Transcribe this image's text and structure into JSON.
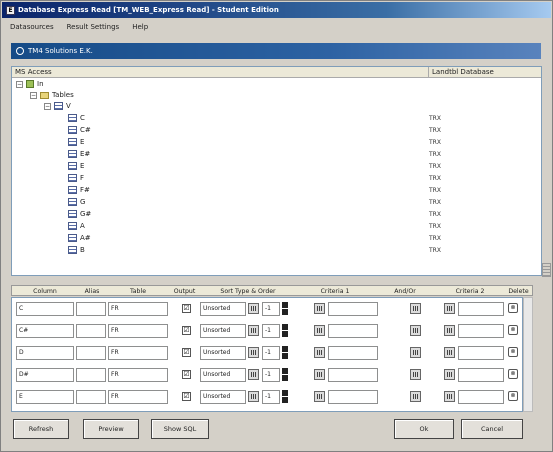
{
  "window": {
    "title": "Database Express Read [TM_WEB_Express Read] - Student Edition",
    "menu": [
      "Datasources",
      "Result Settings",
      "Help"
    ]
  },
  "panel": {
    "title": "TM4 Solutions E.K."
  },
  "tree": {
    "header_left": "MS Access",
    "header_right": "Landtbl Database",
    "root": "In",
    "tables_node": "Tables",
    "sub_node": "V",
    "items": [
      {
        "name": "C",
        "value": "TRX"
      },
      {
        "name": "C#",
        "value": "TRX"
      },
      {
        "name": "E",
        "value": "TRX"
      },
      {
        "name": "E#",
        "value": "TRX"
      },
      {
        "name": "E",
        "value": "TRX"
      },
      {
        "name": "F",
        "value": "TRX"
      },
      {
        "name": "F#",
        "value": "TRX"
      },
      {
        "name": "G",
        "value": "TRX"
      },
      {
        "name": "G#",
        "value": "TRX"
      },
      {
        "name": "A",
        "value": "TRX"
      },
      {
        "name": "A#",
        "value": "TRX"
      },
      {
        "name": "B",
        "value": "TRX"
      }
    ]
  },
  "grid": {
    "headers": [
      "Column",
      "Alias",
      "Table",
      "Output",
      "Sort Type & Order",
      "Criteria 1",
      "And/Or",
      "Criteria 2",
      "Delete"
    ],
    "rows": [
      {
        "column": "C",
        "table": "FR",
        "output": "☑",
        "sort": "Unsorted",
        "order": "-1"
      },
      {
        "column": "C#",
        "table": "FR",
        "output": "☑",
        "sort": "Unsorted",
        "order": "-1"
      },
      {
        "column": "D",
        "table": "FR",
        "output": "☑",
        "sort": "Unsorted",
        "order": "-1"
      },
      {
        "column": "D#",
        "table": "FR",
        "output": "☑",
        "sort": "Unsorted",
        "order": "-1"
      },
      {
        "column": "E",
        "table": "FR",
        "output": "☑",
        "sort": "Unsorted",
        "order": "-1"
      }
    ]
  },
  "buttons": {
    "refresh": "Refresh",
    "preview": "Preview",
    "show_sql": "Show SQL",
    "ok": "Ok",
    "cancel": "Cancel"
  }
}
